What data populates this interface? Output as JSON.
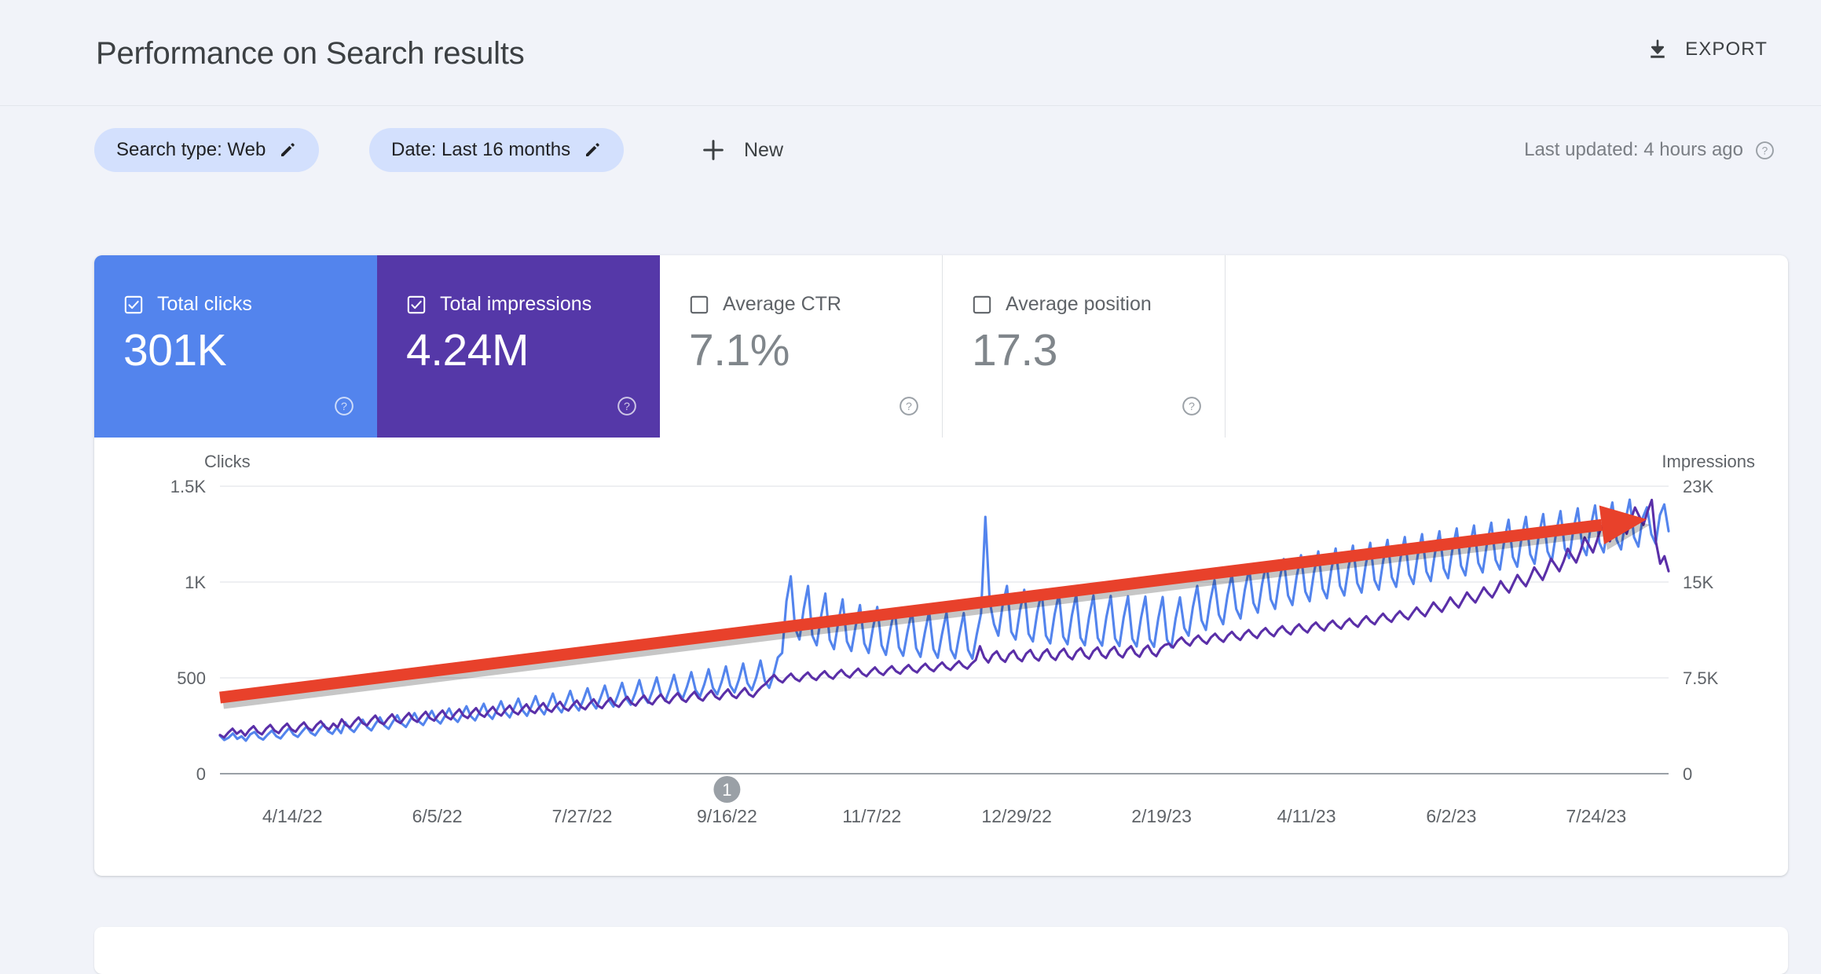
{
  "header": {
    "title": "Performance on Search results",
    "export_label": "EXPORT",
    "export_icon": "download-icon"
  },
  "filters": {
    "chips": [
      {
        "label": "Search type: Web",
        "icon": "pencil-icon"
      },
      {
        "label": "Date: Last 16 months",
        "icon": "pencil-icon"
      }
    ],
    "new_label": "New",
    "new_icon": "plus-icon",
    "last_updated": "Last updated: 4 hours ago",
    "last_updated_icon": "help-icon"
  },
  "metrics": [
    {
      "label": "Total clicks",
      "value": "301K",
      "checked": true,
      "color": "#5384ED",
      "help_icon": "help-icon"
    },
    {
      "label": "Total impressions",
      "value": "4.24M",
      "checked": true,
      "color": "#5538A8",
      "help_icon": "help-icon"
    },
    {
      "label": "Average CTR",
      "value": "7.1%",
      "checked": false,
      "color": "#FFFFFF",
      "help_icon": "help-icon"
    },
    {
      "label": "Average position",
      "value": "17.3",
      "checked": false,
      "color": "#FFFFFF",
      "help_icon": "help-icon"
    }
  ],
  "annotation": {
    "badge_label": "1",
    "badge_color": "#9AA0A6"
  },
  "chart_data": {
    "type": "line",
    "title": "",
    "xlabel": "",
    "grid": true,
    "legend": false,
    "left_axis": {
      "label": "Clicks",
      "ticks": [
        "0",
        "500",
        "1K",
        "1.5K"
      ],
      "min": 0,
      "max": 1500
    },
    "right_axis": {
      "label": "Impressions",
      "ticks": [
        "0",
        "7.5K",
        "15K",
        "23K"
      ],
      "min": 0,
      "max": 23000
    },
    "x_ticks": [
      "4/14/22",
      "6/5/22",
      "7/27/22",
      "9/16/22",
      "11/7/22",
      "12/29/22",
      "2/19/23",
      "4/11/23",
      "6/2/23",
      "7/24/23"
    ],
    "x_start": "4/14/22",
    "x_end": "8/10/23",
    "series": [
      {
        "name": "Clicks",
        "color": "#5384ED",
        "axis": "left",
        "values": [
          198,
          176,
          188,
          210,
          182,
          195,
          172,
          205,
          218,
          190,
          178,
          203,
          225,
          196,
          184,
          212,
          238,
          205,
          192,
          220,
          246,
          214,
          200,
          232,
          258,
          222,
          208,
          240,
          212,
          268,
          236,
          218,
          250,
          282,
          244,
          226,
          262,
          294,
          252,
          234,
          272,
          305,
          262,
          244,
          282,
          316,
          272,
          254,
          292,
          328,
          282,
          262,
          300,
          340,
          292,
          270,
          310,
          352,
          300,
          278,
          320,
          365,
          310,
          286,
          330,
          378,
          320,
          294,
          340,
          392,
          330,
          302,
          350,
          405,
          340,
          310,
          362,
          418,
          350,
          320,
          372,
          432,
          360,
          330,
          384,
          446,
          372,
          340,
          396,
          460,
          382,
          350,
          408,
          474,
          392,
          360,
          418,
          488,
          402,
          370,
          430,
          502,
          412,
          380,
          442,
          516,
          424,
          392,
          454,
          530,
          436,
          402,
          466,
          545,
          448,
          414,
          478,
          560,
          460,
          424,
          490,
          575,
          472,
          436,
          502,
          590,
          484,
          448,
          516,
          606,
          630,
          900,
          1030,
          760,
          700,
          860,
          980,
          720,
          670,
          820,
          940,
          700,
          650,
          790,
          910,
          690,
          640,
          770,
          880,
          680,
          630,
          760,
          870,
          670,
          620,
          750,
          860,
          660,
          615,
          740,
          850,
          655,
          610,
          735,
          845,
          650,
          605,
          730,
          840,
          648,
          602,
          728,
          838,
          646,
          600,
          726,
          836,
          1340,
          900,
          780,
          720,
          880,
          980,
          740,
          700,
          850,
          960,
          730,
          690,
          840,
          950,
          720,
          680,
          830,
          940,
          715,
          675,
          825,
          935,
          710,
          670,
          820,
          930,
          708,
          668,
          818,
          928,
          706,
          666,
          816,
          926,
          704,
          664,
          814,
          924,
          702,
          662,
          812,
          922,
          700,
          660,
          810,
          920,
          760,
          720,
          870,
          980,
          800,
          750,
          900,
          1010,
          830,
          780,
          930,
          1040,
          860,
          810,
          960,
          1070,
          890,
          840,
          990,
          1100,
          910,
          860,
          1010,
          1120,
          930,
          880,
          1030,
          1140,
          950,
          900,
          1050,
          1160,
          965,
          915,
          1065,
          1175,
          980,
          930,
          1080,
          1190,
          995,
          945,
          1095,
          1205,
          1010,
          960,
          1110,
          1220,
          1025,
          975,
          1125,
          1235,
          1040,
          990,
          1140,
          1250,
          1055,
          1005,
          1155,
          1265,
          1070,
          1020,
          1170,
          1280,
          1085,
          1035,
          1185,
          1295,
          1100,
          1050,
          1200,
          1310,
          1115,
          1065,
          1215,
          1325,
          1130,
          1080,
          1230,
          1340,
          1145,
          1095,
          1245,
          1355,
          1160,
          1110,
          1260,
          1370,
          1175,
          1125,
          1275,
          1385,
          1190,
          1140,
          1290,
          1400,
          1205,
          1155,
          1305,
          1415,
          1220,
          1170,
          1320,
          1430,
          1235,
          1185,
          1335,
          1390,
          1250,
          1200,
          1350,
          1405,
          1265
        ]
      },
      {
        "name": "Impressions",
        "color": "#5A2FA8",
        "axis": "right",
        "values": [
          3100,
          2900,
          3300,
          3600,
          3200,
          3450,
          3050,
          3500,
          3800,
          3350,
          3150,
          3600,
          3900,
          3450,
          3250,
          3700,
          4000,
          3550,
          3350,
          3800,
          4100,
          3650,
          3450,
          3900,
          4200,
          3750,
          3550,
          4000,
          3700,
          4350,
          3900,
          3700,
          4150,
          4500,
          4050,
          3850,
          4300,
          4650,
          4150,
          3950,
          4400,
          4750,
          4250,
          4050,
          4500,
          4850,
          4350,
          4150,
          4600,
          4950,
          4450,
          4250,
          4700,
          5050,
          4550,
          4350,
          4800,
          5150,
          4650,
          4450,
          4900,
          5250,
          4750,
          4550,
          5000,
          5350,
          4850,
          4650,
          5100,
          5450,
          4950,
          4750,
          5200,
          5550,
          5050,
          4850,
          5300,
          5650,
          5150,
          4950,
          5400,
          5750,
          5250,
          5050,
          5500,
          5850,
          5350,
          5150,
          5600,
          5950,
          5450,
          5250,
          5700,
          6050,
          5550,
          5350,
          5800,
          6150,
          5650,
          5450,
          5900,
          6250,
          5750,
          5550,
          6000,
          6350,
          5850,
          5650,
          6100,
          6450,
          5950,
          5750,
          6200,
          6550,
          6050,
          5850,
          6300,
          6650,
          6150,
          5950,
          6400,
          6750,
          6250,
          6050,
          6500,
          6850,
          6350,
          6150,
          6600,
          6950,
          7200,
          7600,
          7900,
          7500,
          7300,
          7700,
          8000,
          7600,
          7400,
          7800,
          8100,
          7700,
          7500,
          7900,
          8200,
          7800,
          7600,
          8000,
          8300,
          7900,
          7700,
          8100,
          8400,
          8000,
          7800,
          8200,
          8500,
          8100,
          7900,
          8300,
          8600,
          8200,
          8000,
          8400,
          8700,
          8300,
          8100,
          8500,
          8800,
          8400,
          8200,
          8600,
          8900,
          8500,
          8300,
          8700,
          9000,
          8600,
          8400,
          8800,
          9100,
          10200,
          9300,
          8900,
          9500,
          9800,
          9200,
          8950,
          9550,
          9850,
          9250,
          9000,
          9600,
          9900,
          9300,
          9050,
          9650,
          9950,
          9350,
          9100,
          9700,
          10000,
          9400,
          9150,
          9750,
          10050,
          9450,
          9200,
          9800,
          10100,
          9500,
          9250,
          9850,
          10150,
          9550,
          9300,
          9900,
          10200,
          9600,
          9350,
          9950,
          10250,
          9650,
          9400,
          10000,
          10300,
          10400,
          10100,
          10600,
          10900,
          10500,
          10250,
          10750,
          11050,
          10650,
          10400,
          10900,
          11200,
          10800,
          10550,
          11050,
          11350,
          10950,
          10700,
          11200,
          11500,
          11100,
          10850,
          11350,
          11650,
          11250,
          11000,
          11500,
          11800,
          11400,
          11150,
          11650,
          11950,
          11550,
          11300,
          11800,
          12100,
          11700,
          11450,
          11950,
          12250,
          11850,
          11600,
          12100,
          12400,
          12000,
          11750,
          12250,
          12600,
          12200,
          11950,
          12450,
          12800,
          12400,
          12150,
          12650,
          13000,
          12600,
          12350,
          12850,
          13300,
          12900,
          12600,
          13150,
          13700,
          13300,
          12950,
          13500,
          14100,
          13650,
          13300,
          13900,
          14500,
          14050,
          13700,
          14300,
          14900,
          14450,
          14100,
          14700,
          15400,
          14900,
          14500,
          15200,
          15900,
          15400,
          15000,
          15700,
          16500,
          16000,
          15500,
          16300,
          17200,
          16700,
          16200,
          17000,
          18000,
          17400,
          16900,
          17800,
          18900,
          18300,
          17700,
          18700,
          19800,
          19200,
          18600,
          19600,
          20600,
          19900,
          19200,
          20300,
          21300,
          20600,
          19900,
          21000,
          21900,
          18500,
          16800,
          17400,
          16200
        ]
      }
    ],
    "annotations": [
      {
        "type": "trend-arrow",
        "color": "#E8412B",
        "from": [
          0.0,
          0.265
        ],
        "to": [
          0.985,
          0.885
        ],
        "label": ""
      }
    ]
  }
}
